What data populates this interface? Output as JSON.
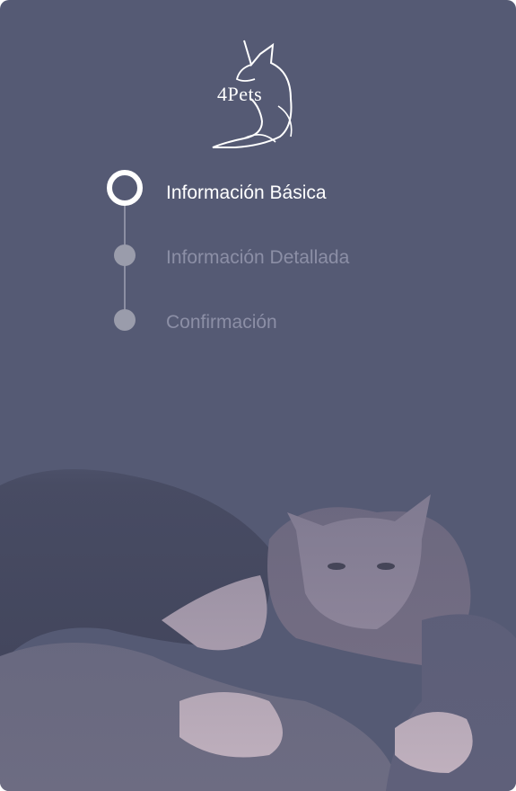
{
  "brand": {
    "logo_text": "4Pets"
  },
  "steps": [
    {
      "label": "Información Básica",
      "state": "active"
    },
    {
      "label": "Información Detallada",
      "state": "inactive"
    },
    {
      "label": "Confirmación",
      "state": "inactive"
    }
  ],
  "colors": {
    "panel_background": "#555a74",
    "active_marker": "#ffffff",
    "inactive_marker": "#9a9cab",
    "inactive_label": "#8c8fa6"
  },
  "icons": [
    "dog-logo-icon"
  ]
}
